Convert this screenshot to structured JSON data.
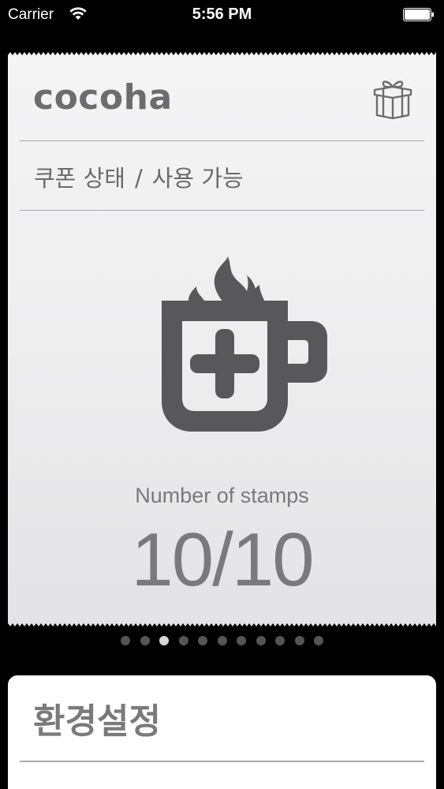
{
  "status_bar": {
    "carrier": "Carrier",
    "time": "5:56 PM",
    "wifi_icon": "wifi-icon",
    "battery_icon": "battery-icon"
  },
  "card": {
    "brand": "cocoha",
    "gift_icon": "gift-icon",
    "status_label": "쿠폰 상태",
    "status_separator": "/",
    "status_value": "사용 가능",
    "main_icon": "coffee-mug-plus-icon",
    "stamps_label": "Number of stamps",
    "stamps_count": "10/10"
  },
  "pager": {
    "total": 11,
    "active_index": 2
  },
  "settings": {
    "title": "환경설정"
  },
  "colors": {
    "background": "#000000",
    "card": "#efeff0",
    "text_gray": "#6d6d6f",
    "icon_gray": "#58585a",
    "dot_inactive": "#555557",
    "dot_active": "#d8d8da"
  }
}
